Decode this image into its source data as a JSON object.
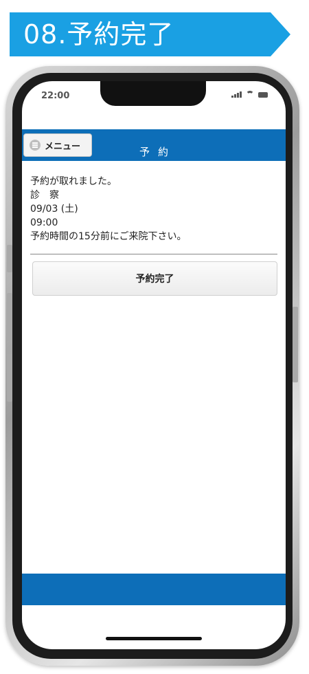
{
  "banner": {
    "title": "08.予約完了"
  },
  "status_bar": {
    "time": "22:00",
    "icons": [
      "signal-icon",
      "wifi-icon",
      "battery-icon"
    ]
  },
  "header": {
    "menu_label": "メニュー",
    "menu_icon": "menu-icon",
    "title": "予約"
  },
  "reservation": {
    "lines": [
      "予約が取れました。",
      "診　察",
      "09/03 (土)",
      "09:00",
      "予約時間の15分前にご来院下さい。"
    ]
  },
  "actions": {
    "complete_label": "予約完了"
  },
  "colors": {
    "banner": "#1aa0e3",
    "header": "#0d6eb8",
    "footer": "#0d6eb8"
  }
}
